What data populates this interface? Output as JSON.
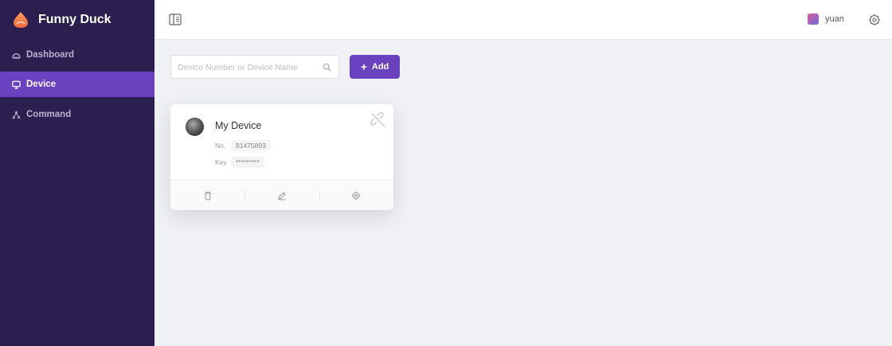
{
  "app": {
    "name": "Funny Duck",
    "brand_color": "#6a42c0",
    "sidebar_color": "#2a1f4f"
  },
  "sidebar": {
    "items": [
      {
        "label": "Dashboard",
        "icon": "dashboard-icon",
        "active": false
      },
      {
        "label": "Device",
        "icon": "monitor-icon",
        "active": true
      },
      {
        "label": "Command",
        "icon": "nodes-icon",
        "active": false
      }
    ]
  },
  "header": {
    "username": "yuan"
  },
  "toolbar": {
    "search_placeholder": "Device Number or Device Name",
    "add_label": "Add"
  },
  "devices": [
    {
      "name": "My Device",
      "no_label": "No.",
      "no_value": "81475893",
      "key_label": "Key",
      "key_value": "*********"
    }
  ]
}
